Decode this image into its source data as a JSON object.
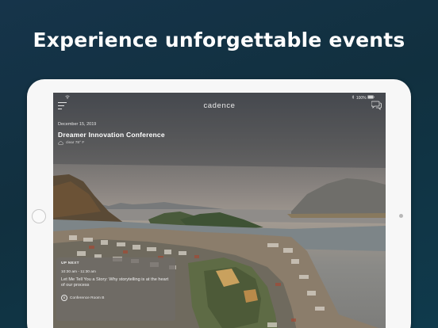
{
  "headline": "Experience unforgettable events",
  "status_bar": {
    "wifi_icon": "wifi-icon",
    "battery": "100%"
  },
  "app": {
    "brand": "cadence"
  },
  "event": {
    "date": "December 15, 2019",
    "title": "Dreamer Innovation Conference",
    "weather": "clear 78° F"
  },
  "up_next": {
    "label": "UP NEXT",
    "time": "10:30 am - 11:30 am",
    "title": "Let Me Tell You a Story: Why storytelling is at the heart of our process",
    "room": "Conference Room B",
    "room_badge": "B"
  },
  "icons": {
    "menu": "hamburger-menu-icon",
    "chat": "chat-bubbles-icon",
    "weather": "cloud-icon",
    "room": "location-badge-icon"
  }
}
